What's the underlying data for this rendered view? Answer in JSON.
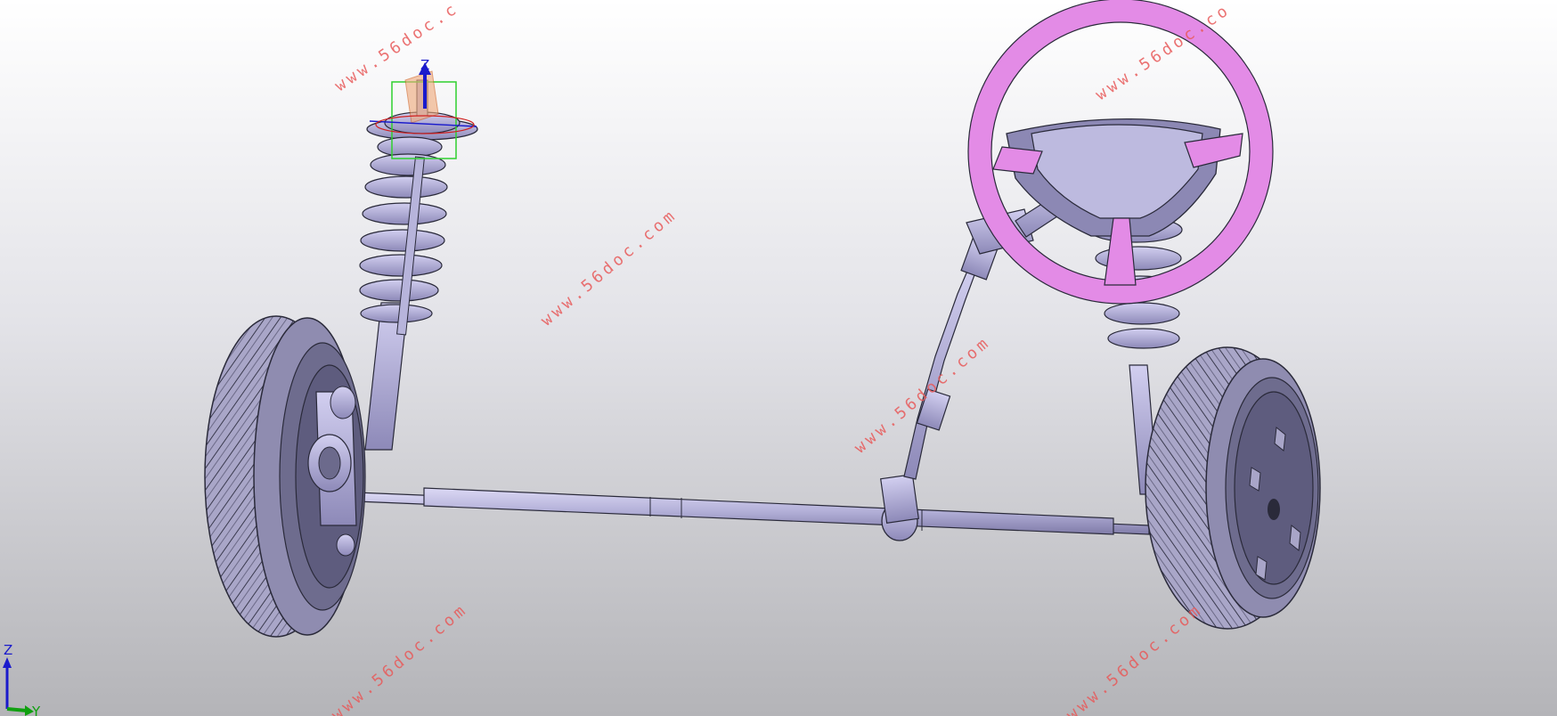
{
  "viewport": {
    "title": ""
  },
  "watermark": {
    "text": "www.56doc.com",
    "text_clipped_top": "www.56doc.c",
    "text_clipped_right": "www.56doc.co",
    "color": "#e85a5a"
  },
  "compass": {
    "z_label": "Z",
    "z_color": "#1a1acc",
    "y_color": "#18b018"
  },
  "triad": {
    "z_label": "Z",
    "y_label": "Y",
    "z_color": "#1a1acc",
    "y_color": "#10a010"
  },
  "colors": {
    "part": "#b9b6d9",
    "part_shade": "#8c88b4",
    "outline": "#2a2a3a",
    "steering_wheel": "#e38be6",
    "steering_wheel_shade": "#b95cc0"
  },
  "icons": [
    "coordinate-compass-icon",
    "axis-triad-icon"
  ]
}
